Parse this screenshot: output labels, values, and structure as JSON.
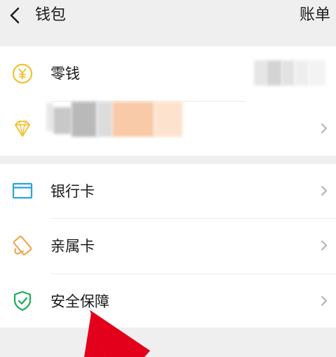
{
  "header": {
    "title": "钱包",
    "action": "账单"
  },
  "icons": {
    "back": "chevron-left-icon",
    "change": "yen-coin-icon",
    "diamond": "diamond-icon",
    "bank_card": "bank-card-icon",
    "family_card": "family-card-icon",
    "security": "shield-check-icon",
    "chevron": "chevron-right-icon"
  },
  "section1": {
    "items": [
      {
        "label": "零钱"
      },
      {
        "label": ""
      }
    ]
  },
  "section2": {
    "items": [
      {
        "label": "银行卡"
      },
      {
        "label": "亲属卡"
      },
      {
        "label": "安全保障"
      }
    ]
  },
  "colors": {
    "background": "#efefef",
    "card": "#ffffff",
    "coin": "#f2c230",
    "diamond": "#f2c230",
    "bank_card": "#2aa3e0",
    "family_card": "#f0a142",
    "security": "#1aad5a",
    "annotation_arrow": "#e2001a"
  }
}
